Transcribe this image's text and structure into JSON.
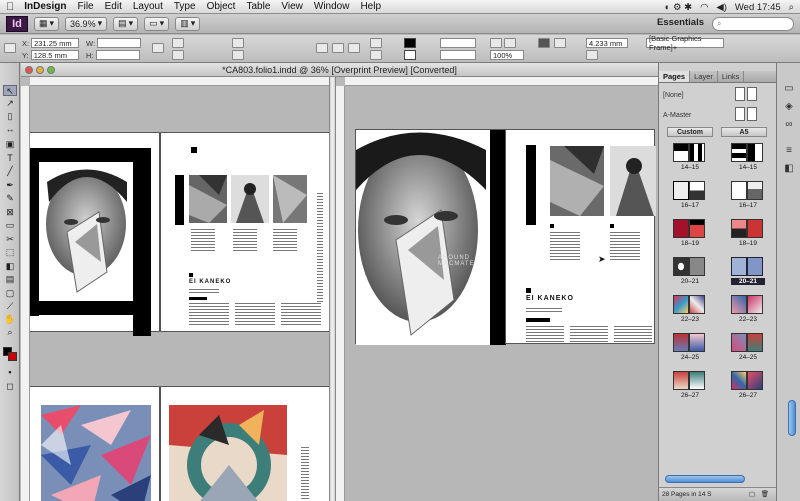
{
  "menubar": {
    "apple": "",
    "items": [
      "InDesign",
      "File",
      "Edit",
      "Layout",
      "Type",
      "Object",
      "Table",
      "View",
      "Window",
      "Help"
    ],
    "clock": "Wed 17:45"
  },
  "appbar": {
    "logo": "Id",
    "zoom": "36.9%",
    "workspace": "Essentials",
    "search_placeholder": ""
  },
  "control": {
    "x_label": "X:",
    "x_value": "231.25 mm",
    "y_label": "Y:",
    "y_value": "128.5 mm",
    "w_label": "W:",
    "h_label": "H:",
    "stroke_weight": "4.233 mm",
    "percent": "100%",
    "frame_style": "[Basic Graphics Frame]+"
  },
  "document": {
    "title": "*CA803.folio1.indd @ 36% [Overprint Preview] [Converted]",
    "left_heading": "EI KANEKO",
    "right_heading": "EI KANEKO",
    "watermark": "AROUND MACMATE"
  },
  "pages_panel": {
    "tabs": [
      "Pages",
      "Layer",
      "Links"
    ],
    "masters": [
      "[None]",
      "A-Master"
    ],
    "col_left": "Custom",
    "col_right": "A5",
    "spreads": [
      "14–15",
      "16–17",
      "18–19",
      "20–21",
      "22–23",
      "24–25",
      "26–27"
    ],
    "selected_spread": "20–21",
    "footer": "28 Pages in 14 S"
  },
  "colors": {
    "accent": "#4f8fd8",
    "selection": "#223344"
  },
  "icons": [
    "apple-icon",
    "wifi-icon",
    "volume-icon",
    "search-icon",
    "selection-tool-icon",
    "type-tool-icon",
    "pen-tool-icon",
    "hand-tool-icon",
    "zoom-tool-icon",
    "pages-icon",
    "layers-icon",
    "links-icon",
    "stroke-icon",
    "swatches-icon"
  ]
}
